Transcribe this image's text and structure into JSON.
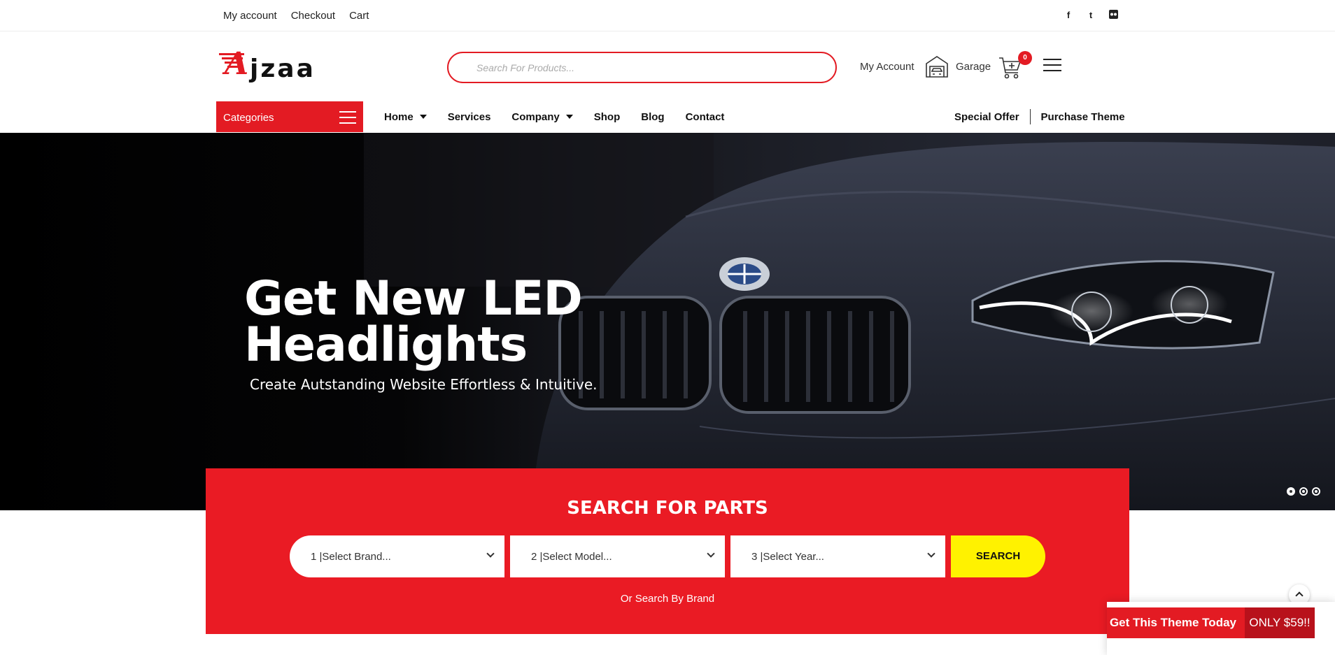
{
  "topbar": {
    "links": [
      "My account",
      "Checkout",
      "Cart"
    ],
    "social": [
      {
        "icon": "facebook-icon",
        "glyph": "f"
      },
      {
        "icon": "twitter-icon",
        "glyph": "t"
      },
      {
        "icon": "flickr-icon",
        "glyph": "●●"
      }
    ]
  },
  "header": {
    "logo_text": "jzaa",
    "logo_letter": "A",
    "search_placeholder": "Search For Products...",
    "account_label": "My Account",
    "garage_label": "Garage",
    "cart_count": "0"
  },
  "nav": {
    "categories_label": "Categories",
    "items": [
      {
        "label": "Home",
        "dropdown": true
      },
      {
        "label": "Services",
        "dropdown": false
      },
      {
        "label": "Company",
        "dropdown": true
      },
      {
        "label": "Shop",
        "dropdown": false
      },
      {
        "label": "Blog",
        "dropdown": false
      },
      {
        "label": "Contact",
        "dropdown": false
      }
    ],
    "special_offer": "Special Offer",
    "purchase_theme": "Purchase Theme"
  },
  "hero": {
    "title_line1": "Get New LED",
    "title_line2": "Headlights",
    "subtitle": "Create Autstanding Website Effortless & Intuitive.",
    "slide_count": 3,
    "active_slide": 1
  },
  "parts_search": {
    "title": "SEARCH FOR PARTS",
    "brand_select": "1 |Select Brand...",
    "model_select": "2 |Select Model...",
    "year_select": "3 |Select Year...",
    "button_label": "SEARCH",
    "by_brand_link": "Or Search By Brand"
  },
  "promo": {
    "text": "Get This Theme Today",
    "price": "ONLY $59!!"
  },
  "colors": {
    "brand_red": "#e31b23",
    "search_button": "#fff200",
    "promo_dark_red": "#b8111b"
  }
}
